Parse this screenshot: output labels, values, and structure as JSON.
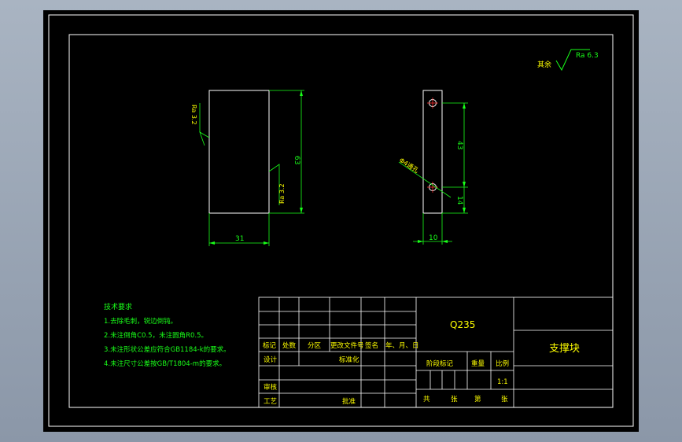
{
  "colors": {
    "background": "#000000",
    "frame": "#ffffff",
    "dimension": "#19ff19",
    "annotation": "#ffff00",
    "center_mark": "#ff3030",
    "app_backdrop": "#9aa5b5"
  },
  "roughness": {
    "other_label": "其余",
    "other_value": "Ra 6.3",
    "left_top": "Ra 3.2",
    "left_side": "Ra 3.2"
  },
  "dimensions": {
    "height": "63",
    "width": "31",
    "hole_spacing": "43",
    "hole_offset": "14",
    "side_width": "10",
    "hole_note": "Φ4通孔"
  },
  "tech_requirements": {
    "title": "技术要求",
    "items": [
      "1.去除毛刺，锐边倒钝。",
      "2.未注倒角C0.5，未注圆角R0.5。",
      "3.未注形状公差应符合GB1184-k的要求。",
      "4.未注尺寸公差按GB/T1804-m的要求。"
    ]
  },
  "title_block": {
    "material": "Q235",
    "part_name": "支撑块",
    "headers": {
      "mark": "标记",
      "count": "处数",
      "zone": "分区",
      "change_doc": "更改文件号",
      "sign": "签名",
      "date": "年、月、日"
    },
    "design": "设计",
    "standardize": "标准化",
    "review": "审核",
    "process": "工艺",
    "approve": "批准",
    "stage_mark": "阶段标记",
    "weight": "重量",
    "scale_label": "比例",
    "scale_value": "1:1",
    "sheets_total": "共",
    "sheet_label": "张",
    "sheet_no": "第",
    "sheet_suffix": "张"
  }
}
